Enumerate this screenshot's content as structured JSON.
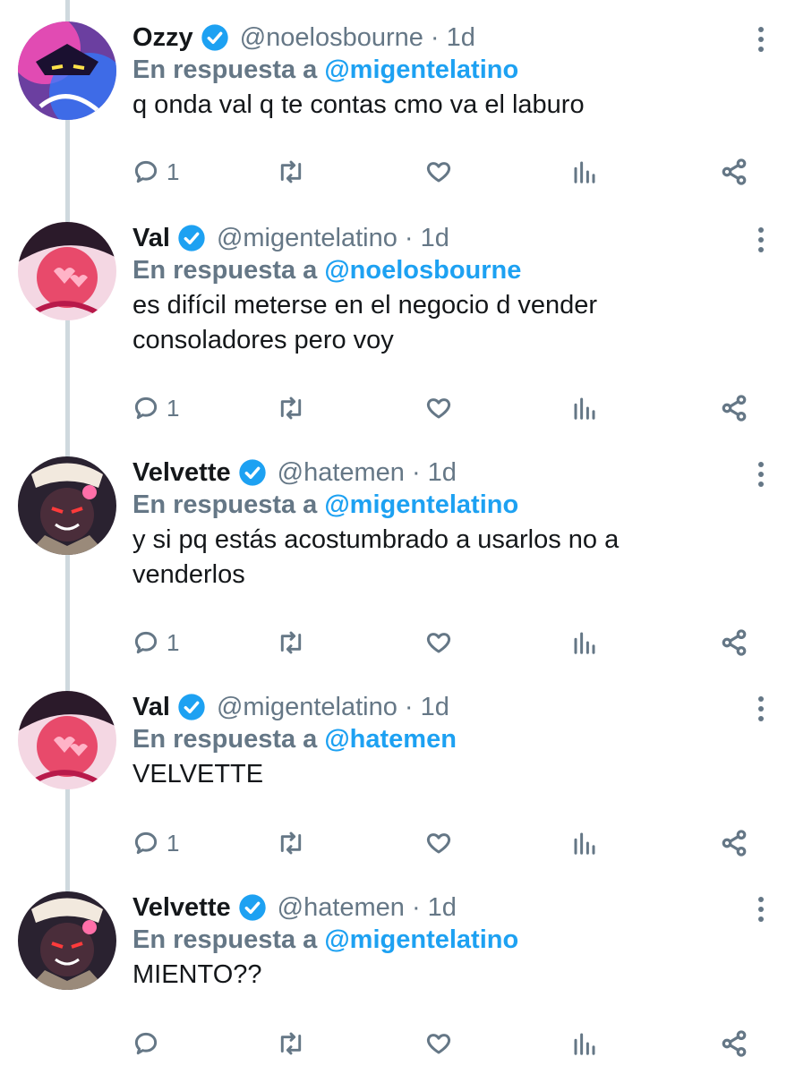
{
  "accent": "#1da1f2",
  "muted": "#657786",
  "reply_prefix": "En respuesta a",
  "tweets": [
    {
      "name": "Ozzy",
      "handle": "@noelosbourne",
      "time": "1d",
      "reply_to": "@migentelatino",
      "text": "q onda val q te contas cmo va el laburo",
      "reply_count": "1",
      "avatar_icon": "avatar-ozzy"
    },
    {
      "name": "Val",
      "handle": "@migentelatino",
      "time": "1d",
      "reply_to": "@noelosbourne",
      "text": "es difícil meterse en el negocio d vender consoladores pero voy",
      "reply_count": "1",
      "avatar_icon": "avatar-val"
    },
    {
      "name": "Velvette",
      "handle": "@hatemen",
      "time": "1d",
      "reply_to": "@migentelatino",
      "text": "y si pq estás acostumbrado a usarlos no a venderlos",
      "reply_count": "1",
      "avatar_icon": "avatar-velvette"
    },
    {
      "name": "Val",
      "handle": "@migentelatino",
      "time": "1d",
      "reply_to": "@hatemen",
      "text": "VELVETTE",
      "reply_count": "1",
      "avatar_icon": "avatar-val"
    },
    {
      "name": "Velvette",
      "handle": "@hatemen",
      "time": "1d",
      "reply_to": "@migentelatino",
      "text": "MIENTO??",
      "reply_count": "",
      "avatar_icon": "avatar-velvette"
    }
  ]
}
